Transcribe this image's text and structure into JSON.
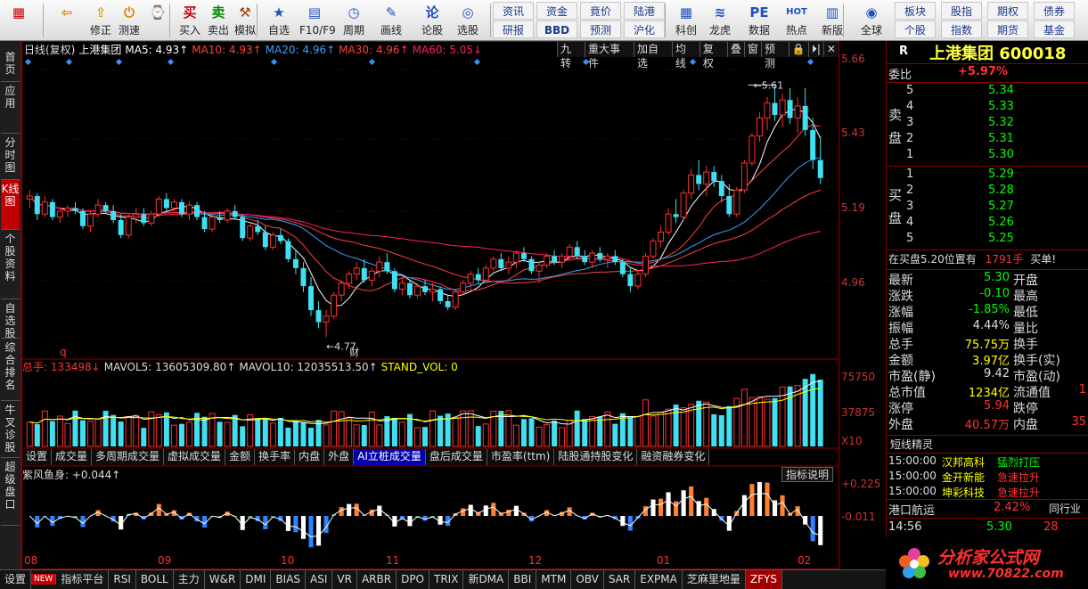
{
  "toolbar": {
    "buttons": [
      {
        "icon": "▦",
        "label": ""
      },
      {
        "icon": "⇦",
        "label": ""
      },
      {
        "icon": "⇧",
        "label": "修正"
      },
      {
        "icon": "⏻",
        "label": "测速"
      },
      {
        "icon": "⌚",
        "label": ""
      },
      {
        "icon": "买",
        "label": "买入"
      },
      {
        "icon": "卖",
        "label": "卖出"
      },
      {
        "icon": "⚒",
        "label": "模拟"
      },
      {
        "icon": "★",
        "label": "自选"
      },
      {
        "icon": "▤",
        "label": "F10/F9"
      },
      {
        "icon": "◷",
        "label": "周期"
      },
      {
        "icon": "✎",
        "label": "画线"
      },
      {
        "icon": "论",
        "label": "论股"
      },
      {
        "icon": "◎",
        "label": "选股"
      }
    ],
    "text_buttons": [
      [
        "资讯",
        "资金",
        "竟价",
        "陆港"
      ],
      [
        "研报",
        "BBD",
        "预测",
        "沪化"
      ]
    ],
    "icon_buttons2": [
      {
        "icon": "▦",
        "label": "科创"
      },
      {
        "icon": "≋",
        "label": "龙虎"
      },
      {
        "icon": "PE",
        "label": "数据"
      },
      {
        "icon": "HOT",
        "label": "热点"
      },
      {
        "icon": "▥",
        "label": "新版"
      },
      {
        "icon": "◉",
        "label": "全球"
      }
    ],
    "text_buttons2": [
      [
        "板块",
        "股指",
        "期权",
        "债券"
      ],
      [
        "个股",
        "指数",
        "期货",
        "基金"
      ]
    ]
  },
  "left_tabs": [
    {
      "label": "首页",
      "active": false
    },
    {
      "label": "应用",
      "active": false
    },
    {
      "label": "分时图",
      "active": false
    },
    {
      "label": "K线图",
      "active": true
    },
    {
      "label": "个股资料",
      "active": false
    },
    {
      "label": "自选股",
      "active": false
    },
    {
      "label": "综合排名",
      "active": false
    },
    {
      "label": "牛叉诊股",
      "active": false
    },
    {
      "label": "超级盘口",
      "active": false
    }
  ],
  "chart_header": {
    "period": "日线(复权)",
    "name": "上港集团",
    "ma": [
      {
        "text": "MA5: 4.93↑",
        "color": "#ffffff"
      },
      {
        "text": "MA10: 4.93↑",
        "color": "#ff4040"
      },
      {
        "text": "MA20: 4.96↑",
        "color": "#3aa0ff"
      },
      {
        "text": "MA30: 4.96↑",
        "color": "#ff4040"
      },
      {
        "text": "MA60: 5.05↓",
        "color": "#ff2060"
      }
    ],
    "buttons": [
      "九转",
      "重大事件",
      "加自选",
      "均线",
      "复权",
      "叠",
      "窗",
      "预测",
      "🔒",
      "⏵|",
      "✕"
    ]
  },
  "price_axis": [
    "5.66",
    "5.43",
    "5.19",
    "4.96"
  ],
  "price_annotations": {
    "high": "5.61",
    "low": "4.77",
    "q_label": "q",
    "cai_label": "财"
  },
  "volume_header": {
    "total": "总手: 133498↓",
    "mavol5": "MAVOL5: 13605309.80↑",
    "mavol10": "MAVOL10: 12035513.50↑",
    "stand": "STAND_VOL: 0"
  },
  "volume_axis": [
    "75750",
    "37875",
    "X10"
  ],
  "indicator_tabs": [
    "设置",
    "成交量",
    "多周期成交量",
    "虚拟成交量",
    "金额",
    "换手率",
    "内盘",
    "外盘",
    "AI立桩成交量",
    "盘后成交量",
    "市盈率(ttm)",
    "陆股通持股变化",
    "融资融券变化"
  ],
  "indicator_tab_active": "AI立桩成交量",
  "macd_header": "紫风鱼身: +0.044↑",
  "macd_help": "指标说明",
  "macd_axis": [
    "+0.225",
    "-0.011"
  ],
  "date_axis": [
    "08",
    "09",
    "10",
    "11",
    "12",
    "01",
    "02"
  ],
  "bottom_tabs": [
    "设置",
    "NEW",
    "指标平台",
    "RSI",
    "BOLL",
    "主力",
    "W&R",
    "DMI",
    "BIAS",
    "ASI",
    "VR",
    "ARBR",
    "DPO",
    "TRIX",
    "新DMA",
    "BBI",
    "MTM",
    "OBV",
    "SAR",
    "EXPMA",
    "芝麻里地量",
    "ZFYS"
  ],
  "bottom_tab_active": "ZFYS",
  "quote": {
    "r_label": "R",
    "title": "上港集团 600018",
    "weibi_label": "委比",
    "weibi_value": "+5.97%",
    "sell_label": "卖盘",
    "buy_label": "买盘",
    "sell": [
      {
        "level": "5",
        "price": "5.34"
      },
      {
        "level": "4",
        "price": "5.33"
      },
      {
        "level": "3",
        "price": "5.32"
      },
      {
        "level": "2",
        "price": "5.31"
      },
      {
        "level": "1",
        "price": "5.30"
      }
    ],
    "buy": [
      {
        "level": "1",
        "price": "5.29"
      },
      {
        "level": "2",
        "price": "5.28"
      },
      {
        "level": "3",
        "price": "5.27"
      },
      {
        "level": "4",
        "price": "5.26"
      },
      {
        "level": "5",
        "price": "5.25"
      }
    ],
    "notice_pre": "在买盘5.20位置有",
    "notice_qty": "1791手",
    "notice_post": "买单!",
    "stats": [
      {
        "l": "最新",
        "v": "5.30",
        "vc": "g",
        "l2": "开盘",
        "v2": ""
      },
      {
        "l": "涨跌",
        "v": "-0.10",
        "vc": "g",
        "l2": "最高",
        "v2": ""
      },
      {
        "l": "涨幅",
        "v": "-1.85%",
        "vc": "g",
        "l2": "最低",
        "v2": ""
      },
      {
        "l": "振幅",
        "v": "4.44%",
        "vc": "w",
        "l2": "量比",
        "v2": ""
      },
      {
        "l": "总手",
        "v": "75.75万",
        "vc": "y",
        "l2": "换手",
        "v2": ""
      },
      {
        "l": "金额",
        "v": "3.97亿",
        "vc": "y",
        "l2": "换手(实)",
        "v2": ""
      },
      {
        "l": "市盈(静)",
        "v": "9.42",
        "vc": "w",
        "l2": "市盈(动)",
        "v2": ""
      },
      {
        "l": "总市值",
        "v": "1234亿",
        "vc": "y",
        "l2": "流通值",
        "v2": "1"
      },
      {
        "l": "涨停",
        "v": "5.94",
        "vc": "r",
        "l2": "跌停",
        "v2": ""
      },
      {
        "l": "外盘",
        "v": "40.57万",
        "vc": "r",
        "l2": "内盘",
        "v2": "35"
      }
    ],
    "elves_title": "短线精灵",
    "elves": [
      {
        "time": "15:00:00",
        "name": "汉邦高科",
        "event": "猛烈打压",
        "ec": "g"
      },
      {
        "time": "15:00:00",
        "name": "金开新能",
        "event": "急速拉升",
        "ec": "r"
      },
      {
        "time": "15:00:00",
        "name": "坤彩科技",
        "event": "急速拉升",
        "ec": "r"
      }
    ],
    "sector_name": "港口航运",
    "sector_pct": "2.42%",
    "sector_link": "同行业",
    "tick_time": "14:56",
    "tick_price": "5.30",
    "tick_vol": "28",
    "logo_text": "分析家公式网",
    "logo_url": "www.70822.com"
  },
  "chart_data": {
    "type": "candlestick",
    "ylim": [
      4.7,
      5.7
    ],
    "ohlc": [
      [
        5.23,
        5.26,
        5.2,
        5.24
      ],
      [
        5.24,
        5.25,
        5.16,
        5.18
      ],
      [
        5.18,
        5.24,
        5.17,
        5.22
      ],
      [
        5.22,
        5.23,
        5.16,
        5.17
      ],
      [
        5.17,
        5.2,
        5.15,
        5.19
      ],
      [
        5.19,
        5.21,
        5.17,
        5.2
      ],
      [
        5.2,
        5.22,
        5.18,
        5.19
      ],
      [
        5.19,
        5.2,
        5.13,
        5.14
      ],
      [
        5.14,
        5.19,
        5.12,
        5.18
      ],
      [
        5.18,
        5.23,
        5.17,
        5.21
      ],
      [
        5.21,
        5.22,
        5.18,
        5.19
      ],
      [
        5.19,
        5.21,
        5.15,
        5.16
      ],
      [
        5.16,
        5.18,
        5.1,
        5.11
      ],
      [
        5.11,
        5.18,
        5.1,
        5.17
      ],
      [
        5.17,
        5.2,
        5.15,
        5.18
      ],
      [
        5.18,
        5.2,
        5.14,
        5.15
      ],
      [
        5.15,
        5.19,
        5.14,
        5.18
      ],
      [
        5.18,
        5.24,
        5.17,
        5.23
      ],
      [
        5.23,
        5.25,
        5.19,
        5.2
      ],
      [
        5.2,
        5.23,
        5.19,
        5.22
      ],
      [
        5.22,
        5.23,
        5.17,
        5.18
      ],
      [
        5.18,
        5.22,
        5.16,
        5.21
      ],
      [
        5.21,
        5.22,
        5.16,
        5.17
      ],
      [
        5.17,
        5.19,
        5.12,
        5.13
      ],
      [
        5.13,
        5.18,
        5.12,
        5.17
      ],
      [
        5.17,
        5.19,
        5.15,
        5.16
      ],
      [
        5.16,
        5.2,
        5.15,
        5.19
      ],
      [
        5.19,
        5.21,
        5.16,
        5.17
      ],
      [
        5.17,
        5.18,
        5.09,
        5.1
      ],
      [
        5.1,
        5.15,
        5.09,
        5.14
      ],
      [
        5.14,
        5.16,
        5.11,
        5.12
      ],
      [
        5.12,
        5.14,
        5.06,
        5.07
      ],
      [
        5.07,
        5.12,
        5.06,
        5.11
      ],
      [
        5.11,
        5.13,
        5.08,
        5.09
      ],
      [
        5.09,
        5.1,
        5.02,
        5.03
      ],
      [
        5.03,
        5.06,
        4.98,
        5.0
      ],
      [
        5.0,
        5.02,
        4.92,
        4.94
      ],
      [
        4.94,
        4.97,
        4.84,
        4.86
      ],
      [
        4.86,
        4.89,
        4.8,
        4.82
      ],
      [
        4.82,
        4.86,
        4.77,
        4.84
      ],
      [
        4.84,
        4.92,
        4.83,
        4.91
      ],
      [
        4.91,
        4.96,
        4.89,
        4.95
      ],
      [
        4.95,
        4.99,
        4.93,
        4.98
      ],
      [
        4.98,
        5.02,
        4.96,
        5.0
      ],
      [
        5.0,
        5.03,
        4.95,
        4.96
      ],
      [
        4.96,
        5.0,
        4.94,
        4.99
      ],
      [
        4.99,
        5.04,
        4.97,
        5.02
      ],
      [
        5.02,
        5.05,
        4.98,
        4.99
      ],
      [
        4.99,
        5.0,
        4.92,
        4.93
      ],
      [
        4.93,
        4.97,
        4.91,
        4.95
      ],
      [
        4.95,
        4.96,
        4.9,
        4.91
      ],
      [
        4.91,
        4.95,
        4.9,
        4.94
      ],
      [
        4.94,
        4.96,
        4.91,
        4.92
      ],
      [
        4.92,
        4.95,
        4.89,
        4.93
      ],
      [
        4.93,
        4.94,
        4.88,
        4.89
      ],
      [
        4.89,
        4.91,
        4.86,
        4.87
      ],
      [
        4.87,
        4.93,
        4.86,
        4.92
      ],
      [
        4.92,
        4.96,
        4.91,
        4.95
      ],
      [
        4.95,
        4.99,
        4.93,
        4.98
      ],
      [
        4.98,
        5.0,
        4.95,
        4.96
      ],
      [
        4.96,
        5.01,
        4.95,
        5.0
      ],
      [
        5.0,
        5.04,
        4.99,
        5.03
      ],
      [
        5.03,
        5.05,
        4.99,
        5.0
      ],
      [
        5.0,
        5.04,
        4.98,
        5.02
      ],
      [
        5.02,
        5.06,
        5.0,
        5.05
      ],
      [
        5.05,
        5.07,
        5.02,
        5.03
      ],
      [
        5.03,
        5.04,
        4.98,
        4.99
      ],
      [
        4.99,
        5.02,
        4.95,
        5.01
      ],
      [
        5.01,
        5.05,
        5.0,
        5.04
      ],
      [
        5.04,
        5.06,
        5.01,
        5.02
      ],
      [
        5.02,
        5.05,
        5.0,
        5.04
      ],
      [
        5.04,
        5.08,
        5.03,
        5.07
      ],
      [
        5.07,
        5.09,
        5.03,
        5.04
      ],
      [
        5.04,
        5.06,
        5.01,
        5.02
      ],
      [
        5.02,
        5.06,
        5.0,
        5.05
      ],
      [
        5.05,
        5.07,
        5.02,
        5.03
      ],
      [
        5.03,
        5.05,
        5.0,
        5.04
      ],
      [
        5.04,
        5.06,
        5.01,
        5.02
      ],
      [
        5.02,
        5.03,
        4.97,
        4.98
      ],
      [
        4.98,
        5.0,
        4.92,
        4.94
      ],
      [
        4.94,
        4.99,
        4.93,
        4.98
      ],
      [
        4.98,
        5.05,
        4.97,
        5.04
      ],
      [
        5.04,
        5.1,
        5.03,
        5.09
      ],
      [
        5.09,
        5.14,
        5.07,
        5.12
      ],
      [
        5.12,
        5.2,
        5.11,
        5.18
      ],
      [
        5.18,
        5.23,
        5.15,
        5.17
      ],
      [
        5.17,
        5.26,
        5.16,
        5.25
      ],
      [
        5.25,
        5.33,
        5.23,
        5.31
      ],
      [
        5.31,
        5.36,
        5.26,
        5.28
      ],
      [
        5.28,
        5.34,
        5.24,
        5.32
      ],
      [
        5.32,
        5.34,
        5.27,
        5.29
      ],
      [
        5.29,
        5.31,
        5.22,
        5.24
      ],
      [
        5.24,
        5.28,
        5.17,
        5.18
      ],
      [
        5.18,
        5.27,
        5.17,
        5.26
      ],
      [
        5.26,
        5.36,
        5.25,
        5.35
      ],
      [
        5.35,
        5.45,
        5.34,
        5.44
      ],
      [
        5.44,
        5.52,
        5.42,
        5.5
      ],
      [
        5.5,
        5.57,
        5.46,
        5.55
      ],
      [
        5.55,
        5.61,
        5.49,
        5.51
      ],
      [
        5.51,
        5.58,
        5.47,
        5.56
      ],
      [
        5.56,
        5.6,
        5.48,
        5.5
      ],
      [
        5.5,
        5.57,
        5.45,
        5.54
      ],
      [
        5.54,
        5.6,
        5.44,
        5.46
      ],
      [
        5.46,
        5.5,
        5.33,
        5.36
      ],
      [
        5.36,
        5.44,
        5.28,
        5.3
      ]
    ],
    "volume_ylim": [
      0,
      75750
    ],
    "macd_ylim": [
      -0.25,
      0.25
    ]
  }
}
